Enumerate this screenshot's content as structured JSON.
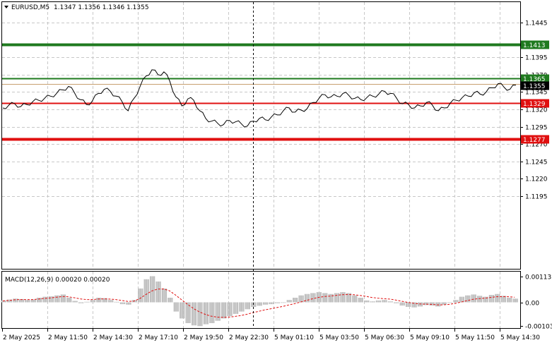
{
  "header": {
    "symbol_tf": "EURUSD,M5",
    "ohlc": "1.1347 1.1356 1.1346 1.1355"
  },
  "price_axis": {
    "ticks": [
      "1.1445",
      "1.1395",
      "1.1370",
      "1.1345",
      "1.1320",
      "1.1295",
      "1.1270",
      "1.1245",
      "1.1220",
      "1.1195"
    ],
    "tick_values": [
      1.1445,
      1.1395,
      1.137,
      1.1345,
      1.132,
      1.1295,
      1.127,
      1.1245,
      1.122,
      1.1195
    ]
  },
  "levels": [
    {
      "label": "1.1413",
      "value": 1.1413,
      "color": "#1f7a1f",
      "thick": true
    },
    {
      "label": "1.1365",
      "value": 1.1365,
      "color": "#1f7a1f",
      "thick": false
    },
    {
      "label": "1.1329",
      "value": 1.1329,
      "color": "#e01010",
      "thick": false
    },
    {
      "label": "1.1277",
      "value": 1.1277,
      "color": "#e01010",
      "thick": true
    }
  ],
  "current_price": {
    "label": "1.1355",
    "value": 1.1355
  },
  "macd": {
    "title": "MACD(12,26,9) 0.00020 0.00020",
    "axis": [
      "0.00113",
      "0.00",
      "-0.00103"
    ],
    "axis_values": [
      0.00113,
      0.0,
      -0.00103
    ]
  },
  "time_axis": {
    "labels": [
      "2 May 2025",
      "2 May 11:50",
      "2 May 14:30",
      "2 May 17:10",
      "2 May 19:50",
      "2 May 22:30",
      "5 May 01:10",
      "5 May 03:50",
      "5 May 06:30",
      "5 May 09:10",
      "5 May 11:50",
      "5 May 14:30"
    ]
  },
  "chart_data": {
    "type": "line",
    "series": [
      {
        "values": [
          1.1322,
          1.1326,
          1.1328,
          1.1324,
          1.1327,
          1.1331,
          1.1333,
          1.1336,
          1.1339,
          1.1343,
          1.1348,
          1.1353,
          1.1344,
          1.1334,
          1.1327,
          1.1332,
          1.1343,
          1.1349,
          1.1346,
          1.1339,
          1.1331,
          1.1318,
          1.1336,
          1.1353,
          1.1368,
          1.1377,
          1.137,
          1.1374,
          1.136,
          1.1338,
          1.1325,
          1.1335,
          1.1333,
          1.1318,
          1.1307,
          1.1303,
          1.13,
          1.1298,
          1.1304,
          1.1302,
          1.1299,
          1.1296,
          1.1303,
          1.1307,
          1.1305,
          1.1309,
          1.1312,
          1.1318,
          1.1322,
          1.1316,
          1.1319,
          1.1321,
          1.133,
          1.1336,
          1.1341,
          1.1338,
          1.1339,
          1.1343,
          1.134,
          1.1336,
          1.1334,
          1.1337,
          1.1339,
          1.1342,
          1.1346,
          1.1343,
          1.1336,
          1.1328,
          1.1327,
          1.1322,
          1.1325,
          1.133,
          1.1326,
          1.1318,
          1.1322,
          1.1329,
          1.1333,
          1.1337,
          1.1339,
          1.1344,
          1.1342,
          1.1345,
          1.1351,
          1.1357,
          1.1352,
          1.1349,
          1.1355
        ]
      }
    ],
    "macd_hist": [
      8e-05,
      0.00012,
      0.00016,
      0.00014,
      0.0001,
      0.00012,
      0.0002,
      0.00024,
      0.00026,
      0.0003,
      0.00034,
      0.0002,
      6e-05,
      -4e-05,
      2e-05,
      0.0001,
      0.0002,
      0.00018,
      0.0001,
      2e-05,
      -8e-05,
      -0.0001,
      0.0001,
      0.0006,
      0.001,
      0.00113,
      0.0009,
      0.0006,
      0.0002,
      -0.0004,
      -0.0007,
      -0.0009,
      -0.001,
      -0.00103,
      -0.00095,
      -0.0009,
      -0.0008,
      -0.0007,
      -0.0006,
      -0.0005,
      -0.0004,
      -0.0003,
      -0.0002,
      -0.00015,
      -0.0001,
      -8e-05,
      -4e-05,
      0.0,
      0.0001,
      0.0002,
      0.0003,
      0.00036,
      0.0004,
      0.00044,
      0.0004,
      0.00036,
      0.0004,
      0.00044,
      0.0004,
      0.0003,
      0.0002,
      8e-05,
      4e-05,
      8e-05,
      0.0001,
      4e-05,
      -4e-05,
      -0.00014,
      -0.0002,
      -0.00022,
      -0.00018,
      -0.00012,
      -0.00014,
      -0.00018,
      -0.0001,
      -2e-05,
      0.0001,
      0.00024,
      0.0003,
      0.00034,
      0.00028,
      0.00024,
      0.00032,
      0.00036,
      0.00028,
      0.0002,
      0.00016
    ],
    "macd_signal": [
      6e-05,
      8e-05,
      0.00011,
      0.00012,
      0.00012,
      0.00012,
      0.00014,
      0.00017,
      0.00019,
      0.00022,
      0.00025,
      0.00024,
      0.0002,
      0.00015,
      0.00012,
      0.00012,
      0.00014,
      0.00015,
      0.00014,
      0.00012,
      8e-05,
      4e-05,
      5e-05,
      0.00016,
      0.00033,
      0.00049,
      0.00057,
      0.00058,
      0.0005,
      0.00032,
      0.00012,
      -8e-05,
      -0.00026,
      -0.00041,
      -0.00052,
      -0.0006,
      -0.00064,
      -0.00065,
      -0.00064,
      -0.00061,
      -0.00057,
      -0.00052,
      -0.00045,
      -0.00039,
      -0.00033,
      -0.00028,
      -0.00023,
      -0.00018,
      -0.00012,
      -6e-05,
      1e-05,
      8e-05,
      0.00015,
      0.00021,
      0.00025,
      0.00027,
      0.0003,
      0.00033,
      0.00034,
      0.00033,
      0.0003,
      0.00026,
      0.00021,
      0.00018,
      0.00016,
      0.00014,
      0.0001,
      5e-05,
      0.0,
      -4e-05,
      -7e-05,
      -8e-05,
      -9e-05,
      -0.00011,
      -0.00011,
      -9e-05,
      -5e-05,
      1e-05,
      7e-05,
      0.00013,
      0.00016,
      0.00018,
      0.00021,
      0.00024,
      0.00025,
      0.00024,
      0.00022
    ]
  }
}
